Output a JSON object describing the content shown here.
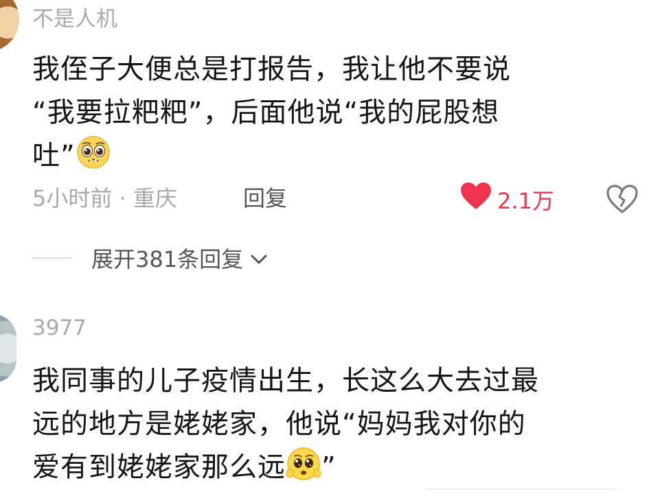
{
  "comments": [
    {
      "username": "不是人机",
      "lines": [
        "我侄子大便总是打报告，我让他不要说",
        "“我要拉粑粑”，后面他说“我的屁股想",
        "吐”"
      ],
      "emoji": "pleading-face-emoji",
      "time_location": "5小时前 · 重庆",
      "reply_label": "回复",
      "like_count": "2.1万",
      "expand_label": "展开381条回复"
    },
    {
      "username": "3977",
      "lines": [
        "我同事的儿子疫情出生，长这么大去过最",
        "远的地方是姥姥家，他说“妈妈我对你的",
        "爱有到姥姥家那么远"
      ],
      "line3_suffix": "”",
      "emoji": "pleading-face-emoji"
    }
  ],
  "icons": {
    "like": "heart-icon",
    "dislike": "broken-heart-icon",
    "expand": "chevron-down-icon"
  },
  "colors": {
    "like": "#f0344d",
    "username": "#a9a9a9",
    "text": "#141414"
  }
}
